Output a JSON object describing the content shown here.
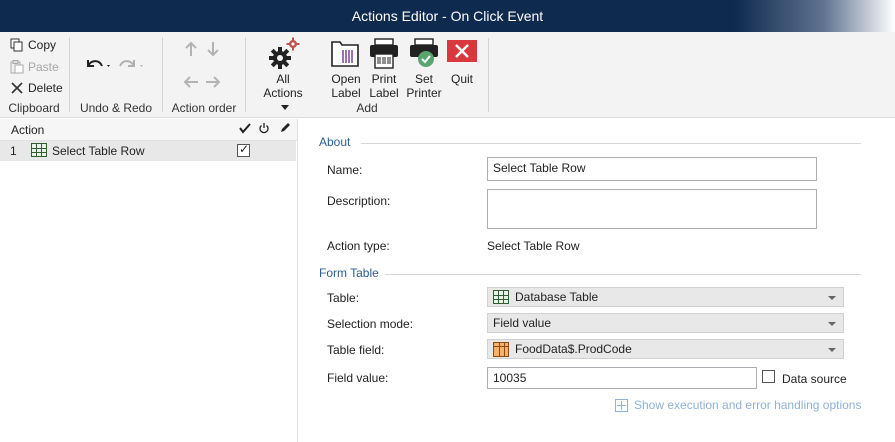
{
  "window": {
    "title": "Actions Editor - On Click Event"
  },
  "ribbon": {
    "clipboard": {
      "copy": "Copy",
      "paste": "Paste",
      "delete": "Delete",
      "group_label": "Clipboard"
    },
    "undo_redo": {
      "group_label": "Undo & Redo"
    },
    "action_order": {
      "group_label": "Action order"
    },
    "add": {
      "all_actions_line1": "All",
      "all_actions_line2": "Actions",
      "open_label_line1": "Open",
      "open_label_line2": "Label",
      "print_label_line1": "Print",
      "print_label_line2": "Label",
      "set_printer_line1": "Set",
      "set_printer_line2": "Printer",
      "quit": "Quit",
      "group_label": "Add"
    }
  },
  "action_list": {
    "header": "Action",
    "rows": [
      {
        "number": "1",
        "label": "Select Table Row",
        "enabled": true
      }
    ]
  },
  "about": {
    "section_title": "About",
    "name_label": "Name:",
    "name_value": "Select Table Row",
    "description_label": "Description:",
    "description_value": "",
    "action_type_label": "Action type:",
    "action_type_value": "Select Table Row"
  },
  "form_table": {
    "section_title": "Form Table",
    "table_label": "Table:",
    "table_value": "Database Table",
    "selection_mode_label": "Selection mode:",
    "selection_mode_value": "Field value",
    "table_field_label": "Table field:",
    "table_field_value": "FoodData$.ProdCode",
    "field_value_label": "Field value:",
    "field_value_value": "10035",
    "data_source_label": "Data source"
  },
  "footer": {
    "show_options_link": "Show execution and error handling options"
  },
  "colors": {
    "titlebar": "#0f2a4f",
    "section_title": "#2e5d8f",
    "quit_red": "#d9393c",
    "link": "#8fb1d4"
  },
  "icons": [
    "copy-icon",
    "paste-icon",
    "delete-icon",
    "undo-icon",
    "redo-icon",
    "move-up-icon",
    "move-down-icon",
    "move-left-icon",
    "move-right-icon",
    "all-actions-gear-icon",
    "open-label-icon",
    "print-label-icon",
    "set-printer-icon",
    "quit-icon",
    "table-icon",
    "field-icon",
    "plus-icon",
    "check-icon",
    "power-icon",
    "pencil-icon"
  ]
}
